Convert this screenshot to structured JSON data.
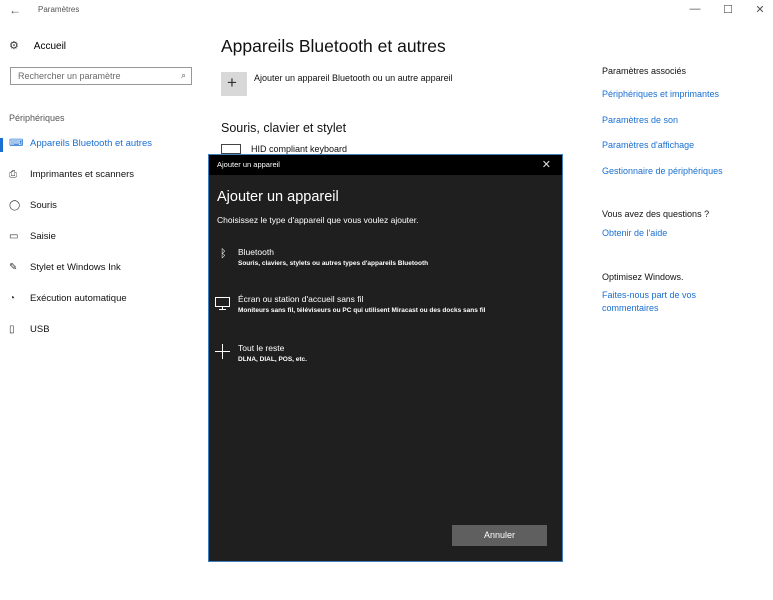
{
  "window": {
    "title": "Paramètres",
    "back_glyph": "←",
    "minimize_glyph": "—",
    "maximize_glyph": "☐",
    "close_glyph": "✕"
  },
  "sidebar": {
    "home_label": "Accueil",
    "search_placeholder": "Rechercher un paramètre",
    "section_label": "Périphériques",
    "items": [
      {
        "label": "Appareils Bluetooth et autres",
        "icon": "bluetooth-devices-icon",
        "active": true
      },
      {
        "label": "Imprimantes et scanners",
        "icon": "printer-icon",
        "active": false
      },
      {
        "label": "Souris",
        "icon": "mouse-icon",
        "active": false
      },
      {
        "label": "Saisie",
        "icon": "keyboard-icon",
        "active": false
      },
      {
        "label": "Stylet et Windows Ink",
        "icon": "pen-icon",
        "active": false
      },
      {
        "label": "Exécution automatique",
        "icon": "autoplay-icon",
        "active": false
      },
      {
        "label": "USB",
        "icon": "usb-icon",
        "active": false
      }
    ]
  },
  "main": {
    "title": "Appareils Bluetooth et autres",
    "add_label": "Ajouter un appareil Bluetooth ou un autre appareil",
    "section_title": "Souris, clavier et stylet",
    "device_name": "HID compliant keyboard"
  },
  "right": {
    "related_title": "Paramètres associés",
    "related_links": [
      "Périphériques et imprimantes",
      "Paramètres de son",
      "Paramètres d'affichage",
      "Gestionnaire de périphériques"
    ],
    "questions_title": "Vous avez des questions ?",
    "help_link": "Obtenir de l'aide",
    "improve_title": "Optimisez Windows.",
    "feedback_link_1": "Faites-nous part de vos",
    "feedback_link_2": "commentaires"
  },
  "dialog": {
    "titlebar": "Ajouter un appareil",
    "heading": "Ajouter un appareil",
    "subtitle": "Choisissez le type d'appareil que vous voulez ajouter.",
    "options": [
      {
        "title": "Bluetooth",
        "desc": "Souris, claviers, stylets ou autres types d'appareils Bluetooth",
        "icon": "bluetooth-icon"
      },
      {
        "title": "Écran ou station d'accueil sans fil",
        "desc": "Moniteurs sans fil, téléviseurs ou PC qui utilisent Miracast ou des docks sans fil",
        "icon": "monitor-icon"
      },
      {
        "title": "Tout le reste",
        "desc": "DLNA, DIAL, POS, etc.",
        "icon": "plus-icon"
      }
    ],
    "cancel_label": "Annuler"
  },
  "colors": {
    "accent": "#1a6fd1",
    "dialog_bg": "#1f1f1f",
    "dialog_border": "#3e7fbf",
    "button_bg": "#5f5f5f"
  }
}
